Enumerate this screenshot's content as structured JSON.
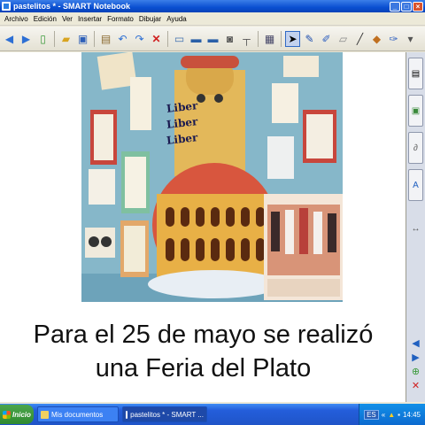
{
  "window": {
    "title": "pastelitos * - SMART Notebook",
    "controls": [
      "_",
      "□",
      "×"
    ]
  },
  "menu": [
    "Archivo",
    "Edición",
    "Ver",
    "Insertar",
    "Formato",
    "Dibujar",
    "Ayuda"
  ],
  "toolbar_icons": [
    "back-icon",
    "forward-icon",
    "add-page-icon",
    "open-icon",
    "save-icon",
    "paste-icon",
    "undo-icon",
    "redo-icon",
    "delete-icon",
    "screen-shade-icon",
    "full-screen-icon",
    "dual-page-icon",
    "screen-capture-icon",
    "document-camera-icon",
    "table-icon",
    "select-icon",
    "pen-icon",
    "creative-pen-icon",
    "eraser-icon",
    "line-icon",
    "shapes-icon",
    "fill-icon",
    "properties-icon"
  ],
  "page": {
    "caption_line1": "Para el 25 de mayo se realizó",
    "caption_line2": "una Feria del Plato",
    "photo_text": [
      "Liber",
      "Liber",
      "Liber"
    ]
  },
  "side_tabs": [
    "page-sorter-icon",
    "gallery-icon",
    "attachments-icon",
    "properties-icon"
  ],
  "taskbar": {
    "start_label": "Inicio",
    "tasks": [
      "Mis documentos",
      "pastelitos * - SMART ..."
    ],
    "lang": "ES",
    "time": "14:45"
  },
  "colors": {
    "titlebar": "#0a4fd1",
    "taskbar": "#245edb",
    "photo_bg": "#7fb3c8"
  }
}
